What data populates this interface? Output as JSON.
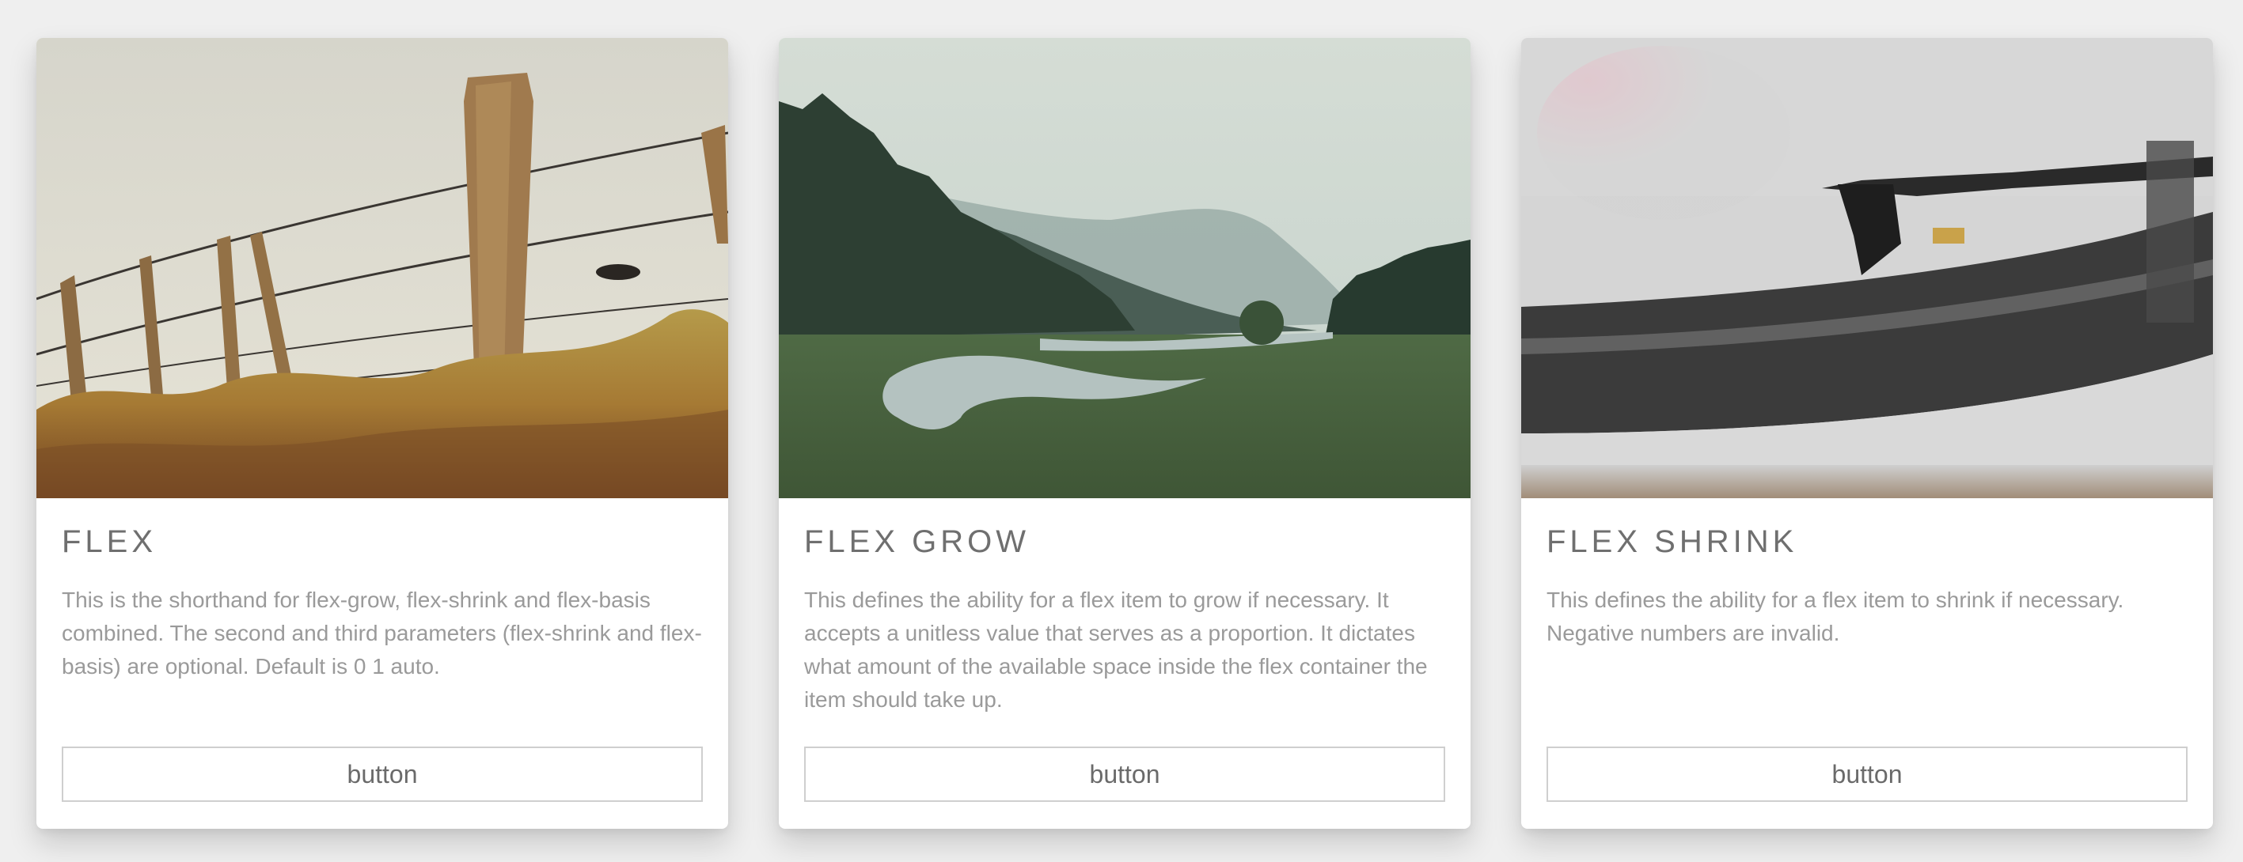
{
  "cards": [
    {
      "title": "FLEX",
      "text": "This is the shorthand for flex-grow, flex-shrink and flex-basis combined. The second and third parameters (flex-shrink and flex-basis) are optional. Default is 0 1 auto.",
      "button_label": "button",
      "image_icon": "fence-photo"
    },
    {
      "title": "FLEX GROW",
      "text": "This defines the ability for a flex item to grow if necessary. It accepts a unitless value that serves as a proportion. It dictates what amount of the available space inside the flex container the item should take up.",
      "button_label": "button",
      "image_icon": "river-landscape-photo"
    },
    {
      "title": "FLEX SHRINK",
      "text": "This defines the ability for a flex item to shrink if necessary. Negative numbers are invalid.",
      "button_label": "button",
      "image_icon": "turntable-photo"
    }
  ],
  "colors": {
    "background": "#efefef",
    "card": "#ffffff",
    "title": "#6f6f6f",
    "text": "#9a9a9a",
    "button_border": "#cfcfcf"
  }
}
